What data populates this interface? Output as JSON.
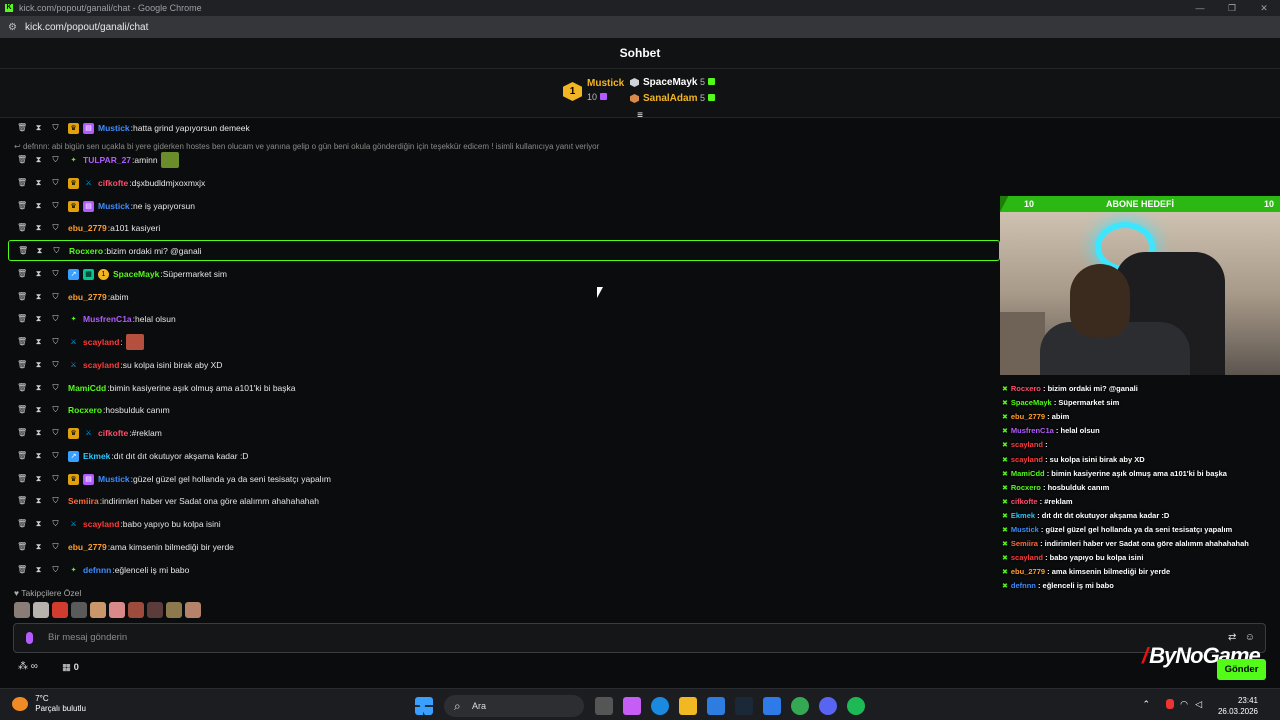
{
  "window": {
    "tab_title": "kick.com/popout/ganali/chat - Google Chrome",
    "url": "kick.com/popout/ganali/chat"
  },
  "chat_header": {
    "title": "Sohbet"
  },
  "leaderboard": {
    "first": {
      "rank": "1",
      "name": "Mustick",
      "count": "10"
    },
    "second": {
      "name": "SpaceMayk",
      "count": "5"
    },
    "third": {
      "name": "SanalAdam",
      "count": "5"
    }
  },
  "reply_preview": "defnnn: abi bigün sen uçakla bi yere giderken hostes ben olucam ve yanına gelip o gün beni okula gönderdiğin için teşekkür edicem ! isimli kullanıcıya yanıt veriyor",
  "messages": [
    {
      "user": "Mustick",
      "text": "hatta grind yapıyorsun demeek",
      "color": "#3d8cff",
      "badges": [
        "crown",
        "sub"
      ]
    },
    {
      "user": "TULPAR_27",
      "text": "aminn",
      "color": "#b25cff",
      "badges": [
        "vip"
      ],
      "emote": "#6a8c2b"
    },
    {
      "user": "cifkofte",
      "text": "dşxbudldmjxoxmxjx",
      "color": "#ff4e6b",
      "badges": [
        "crown",
        "mod"
      ]
    },
    {
      "user": "Mustick",
      "text": "ne iş yapıyorsun",
      "color": "#3d8cff",
      "badges": [
        "crown",
        "sub"
      ]
    },
    {
      "user": "ebu_2779",
      "text": "a101 kasiyeri",
      "color": "#ff9d2e",
      "badges": []
    },
    {
      "user": "Rocxero",
      "text": "bizim ordaki mi? @ganali",
      "color": "#53fc18",
      "badges": [],
      "highlight": true
    },
    {
      "user": "SpaceMayk",
      "text": "Süpermarket sim",
      "color": "#53fc18",
      "badges": [
        "og",
        "gift",
        "one"
      ]
    },
    {
      "user": "ebu_2779",
      "text": "abim",
      "color": "#ff9d2e",
      "badges": []
    },
    {
      "user": "MusfrenC1a",
      "text": "helal olsun",
      "color": "#b25cff",
      "badges": [
        "vip"
      ]
    },
    {
      "user": "scayland",
      "text": "",
      "color": "#ff3b3b",
      "badges": [
        "mod"
      ],
      "emote": "#b5503e"
    },
    {
      "user": "scayland",
      "text": "su kolpa isini birak aby XD",
      "color": "#ff3b3b",
      "badges": [
        "mod"
      ]
    },
    {
      "user": "MamiCdd",
      "text": "bimin kasiyerine aşık olmuş ama a101'ki bi başka",
      "color": "#53fc18",
      "badges": []
    },
    {
      "user": "Rocxero",
      "text": "hosbulduk canım",
      "color": "#53fc18",
      "badges": []
    },
    {
      "user": "cifkofte",
      "text": "#reklam",
      "color": "#ff4e6b",
      "badges": [
        "crown",
        "mod"
      ]
    },
    {
      "user": "Ekmek",
      "text": "dıt dıt dıt okutuyor akşama kadar :D",
      "color": "#29c7ff",
      "badges": [
        "og"
      ]
    },
    {
      "user": "Mustick",
      "text": "güzel güzel gel hollanda ya da seni tesisatçı yapalım",
      "color": "#3d8cff",
      "badges": [
        "crown",
        "sub"
      ]
    },
    {
      "user": "Semiira",
      "text": "indirimleri haber ver Sadat ona göre alalımm ahahahahah",
      "color": "#ff6b3d",
      "badges": []
    },
    {
      "user": "scayland",
      "text": "babo yapıyo bu kolpa isini",
      "color": "#ff3b3b",
      "badges": [
        "mod"
      ]
    },
    {
      "user": "ebu_2779",
      "text": "ama kimsenin bilmediği bir yerde",
      "color": "#ff9d2e",
      "badges": []
    },
    {
      "user": "defnnn",
      "text": "eğlenceli iş mi babo",
      "color": "#3d8cff",
      "badges": [
        "vip"
      ]
    }
  ],
  "followers_label": "Takipçilere Özel",
  "input_placeholder": "Bir mesaj gönderin",
  "bottom_bar": {
    "infinity": "∞",
    "count": "0"
  },
  "send_label": "Gönder",
  "brand_text": "ByNoGame",
  "overlay": {
    "goal_left": "10",
    "goal_title": "ABONE HEDEFİ",
    "goal_right": "10",
    "goal_progress": 1.0,
    "chat": [
      {
        "user": "Rocxero",
        "text": "bizim ordaki mi? @ganali",
        "color": "#ff4e6b"
      },
      {
        "user": "SpaceMayk",
        "text": "Süpermarket sim",
        "color": "#53fc18"
      },
      {
        "user": "ebu_2779",
        "text": "abim",
        "color": "#ff9d2e"
      },
      {
        "user": "MusfrenC1a",
        "text": "helal olsun",
        "color": "#b25cff"
      },
      {
        "user": "scayland",
        "text": "",
        "color": "#ff3b3b"
      },
      {
        "user": "scayland",
        "text": "su kolpa isini birak aby XD",
        "color": "#ff3b3b"
      },
      {
        "user": "MamiCdd",
        "text": "bimin kasiyerine aşık olmuş ama a101'ki bi başka",
        "color": "#53fc18"
      },
      {
        "user": "Rocxero",
        "text": "hosbulduk canım",
        "color": "#53fc18"
      },
      {
        "user": "cifkofte",
        "text": "#reklam",
        "color": "#ff4e6b"
      },
      {
        "user": "Ekmek",
        "text": "dıt dıt dıt okutuyor akşama kadar :D",
        "color": "#29c7ff"
      },
      {
        "user": "Mustick",
        "text": "güzel güzel gel hollanda ya da seni tesisatçı yapalım",
        "color": "#3d8cff"
      },
      {
        "user": "Semiira",
        "text": "indirimleri haber ver Sadat ona göre alalımm ahahahahah",
        "color": "#ff6b3d"
      },
      {
        "user": "scayland",
        "text": "babo yapıyo bu kolpa isini",
        "color": "#ff3b3b"
      },
      {
        "user": "ebu_2779",
        "text": "ama kimsenin bilmediği bir yerde",
        "color": "#ff9d2e"
      },
      {
        "user": "defnnn",
        "text": "eğlenceli iş mi babo",
        "color": "#3d8cff"
      }
    ]
  },
  "taskbar": {
    "temperature": "7°C",
    "weather": "Parçalı bulutlu",
    "search": "Ara",
    "time": "23:41",
    "date": "26.03.2026"
  }
}
